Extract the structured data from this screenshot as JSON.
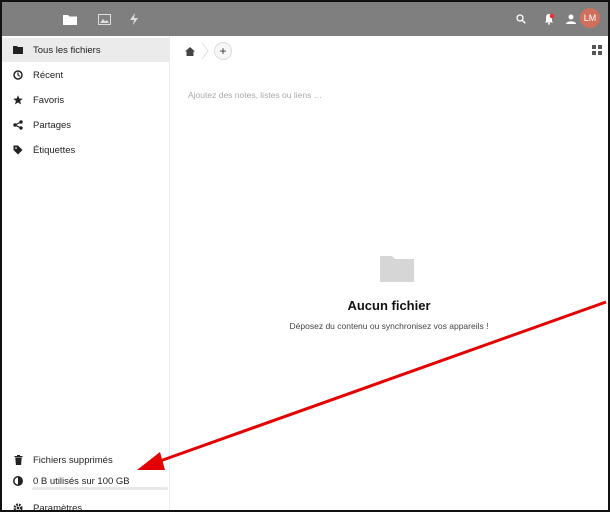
{
  "header": {
    "apps": [
      {
        "name": "files-app-icon"
      },
      {
        "name": "photos-app-icon"
      },
      {
        "name": "activity-app-icon"
      }
    ],
    "avatar_initials": "LM"
  },
  "sidebar": {
    "items": [
      {
        "label": "Tous les fichiers",
        "icon": "folder-icon",
        "active": true
      },
      {
        "label": "Récent",
        "icon": "clock-icon"
      },
      {
        "label": "Favoris",
        "icon": "star-icon"
      },
      {
        "label": "Partages",
        "icon": "share-icon"
      },
      {
        "label": "Étiquettes",
        "icon": "tag-icon"
      }
    ],
    "deleted_label": "Fichiers supprimés",
    "quota_label": "0 B utilisés sur 100 GB",
    "quota_fraction": 0.0,
    "settings_label": "Paramètres"
  },
  "main": {
    "notes_placeholder": "Ajoutez des notes, listes ou liens …",
    "empty_title": "Aucun fichier",
    "empty_subtitle": "Déposez du contenu ou synchronisez vos appareils !"
  },
  "colors": {
    "header": "#7f7f7f",
    "accent": "#0082c9",
    "annotation_arrow": "#e30000"
  }
}
